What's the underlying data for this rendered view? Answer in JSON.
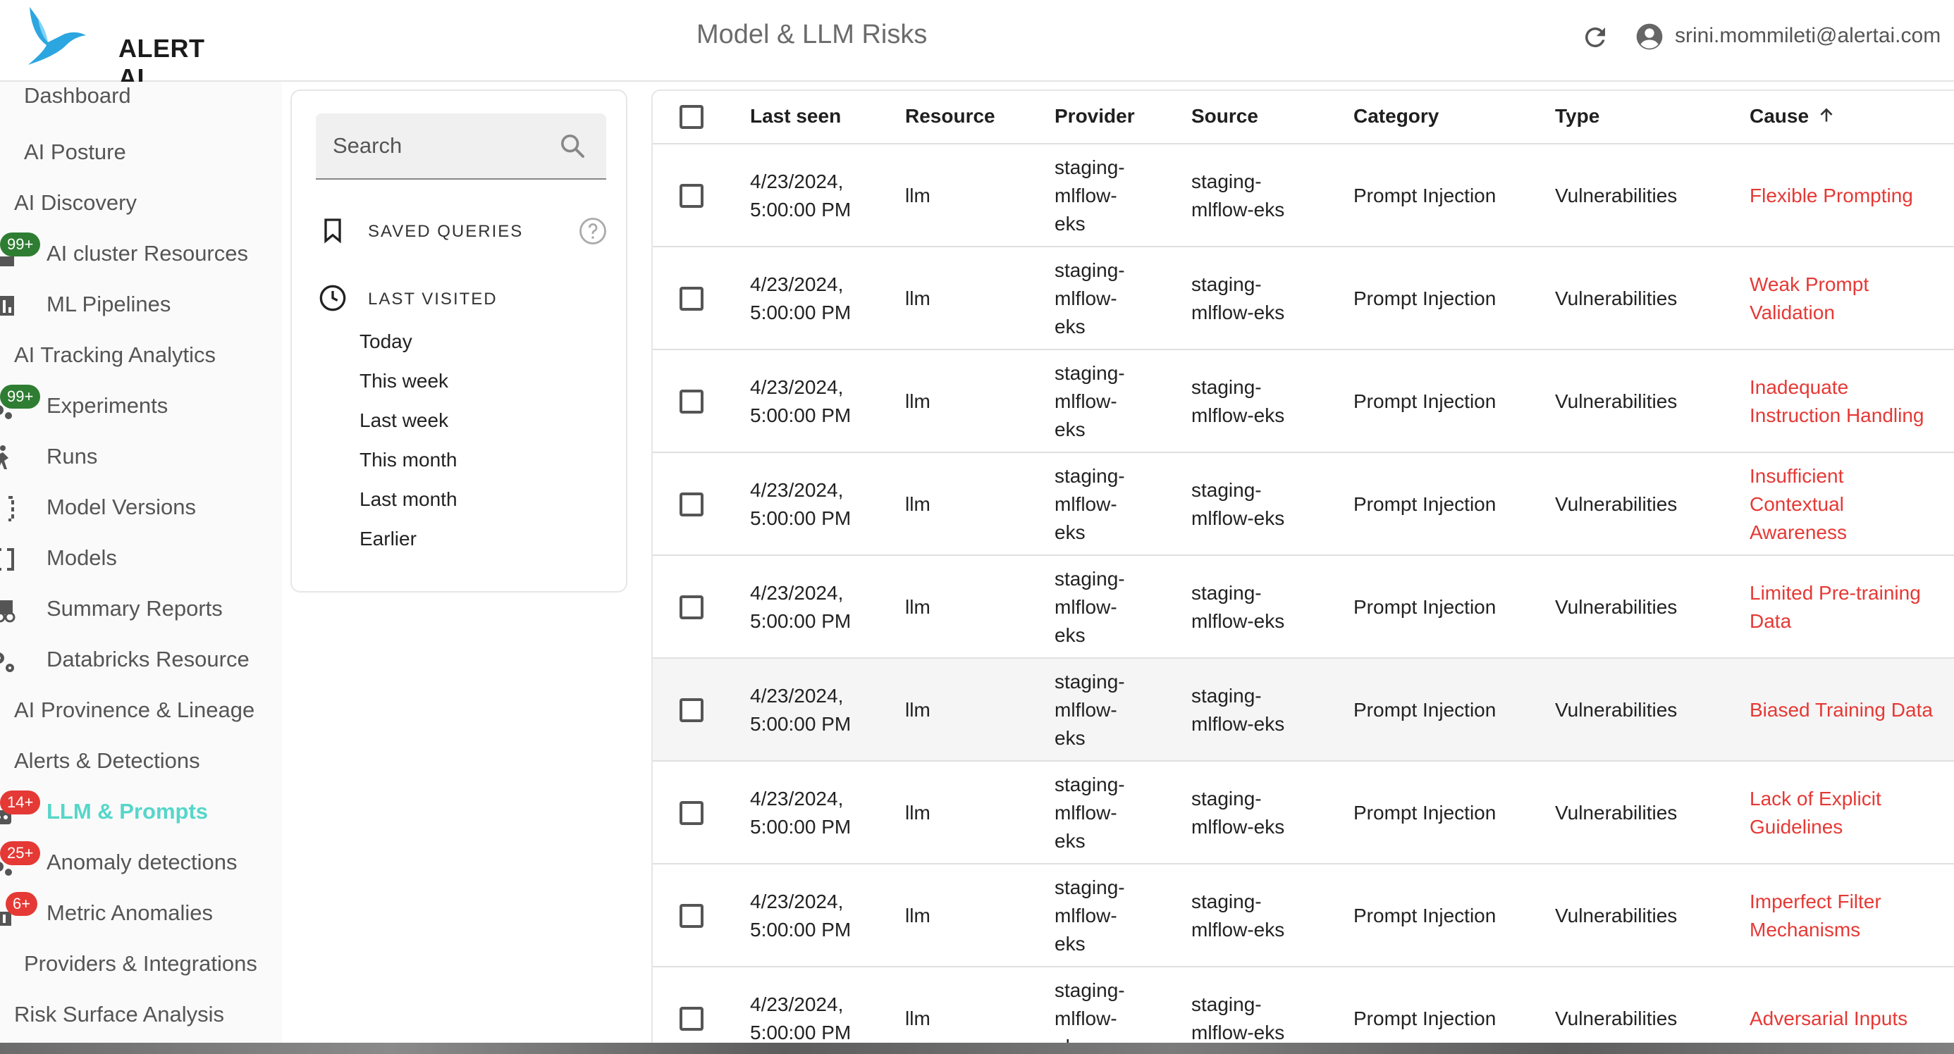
{
  "header": {
    "logo_text": "ALERT AI",
    "page_title": "Model & LLM Risks",
    "user_email": "srini.mommileti@alertai.com",
    "icons": {
      "refresh": "refresh-icon",
      "account": "account-circle-icon"
    },
    "brand_color": "#2ca6e0"
  },
  "sidebar": {
    "active_color": "#56d6c9",
    "items": [
      {
        "label": "Dashboard",
        "icon": null,
        "badge": null
      },
      {
        "label": "AI Posture",
        "icon": null,
        "badge": null
      },
      {
        "label": "AI Discovery",
        "icon": null,
        "badge": null
      },
      {
        "label": "AI cluster Resources",
        "icon": "dns-icon",
        "badge": "99+"
      },
      {
        "label": "ML Pipelines",
        "icon": "bar-chart-icon",
        "badge": null
      },
      {
        "label": "AI Tracking Analytics",
        "icon": null,
        "badge": null
      },
      {
        "label": "Experiments",
        "icon": "settings-cluster-icon",
        "badge": "99+"
      },
      {
        "label": "Runs",
        "icon": "runner-icon",
        "badge": null
      },
      {
        "label": "Model Versions",
        "icon": "bracket-icon",
        "badge": null
      },
      {
        "label": "Models",
        "icon": "bracket-icon",
        "badge": null
      },
      {
        "label": "Summary Reports",
        "icon": "report-icon",
        "badge": null
      },
      {
        "label": "Databricks Resource",
        "icon": "gears-icon",
        "badge": null
      },
      {
        "label": "AI Provinence & Lineage",
        "icon": null,
        "badge": null
      },
      {
        "label": "Alerts & Detections",
        "icon": null,
        "badge": null
      },
      {
        "label": "LLM & Prompts",
        "icon": "robot-icon",
        "badge": "14+"
      },
      {
        "label": "Anomaly detections",
        "icon": "gears-icon",
        "badge": "25+"
      },
      {
        "label": "Metric Anomalies",
        "icon": "bar-chart-icon",
        "badge": "6+"
      },
      {
        "label": "Providers & Integrations",
        "icon": null,
        "badge": null
      },
      {
        "label": "Risk Surface Analysis",
        "icon": null,
        "badge": null
      }
    ]
  },
  "filters": {
    "search_placeholder": "Search",
    "saved_queries_label": "SAVED QUERIES",
    "last_visited_label": "LAST VISITED",
    "last_visited_items": [
      "Today",
      "This week",
      "Last week",
      "This month",
      "Last month",
      "Earlier"
    ]
  },
  "table": {
    "columns": [
      "Last seen",
      "Resource",
      "Provider",
      "Source",
      "Category",
      "Type",
      "Cause"
    ],
    "sort_column": "Cause",
    "sort_direction": "ascending",
    "rows": [
      {
        "last_seen": "4/23/2024,\n5:00:00 PM",
        "resource": "llm",
        "provider": "staging-\nmlflow-\neks",
        "source": "staging-\nmlflow-eks",
        "category": "Prompt Injection",
        "type": "Vulnerabilities",
        "cause": "Flexible Prompting"
      },
      {
        "last_seen": "4/23/2024,\n5:00:00 PM",
        "resource": "llm",
        "provider": "staging-\nmlflow-\neks",
        "source": "staging-\nmlflow-eks",
        "category": "Prompt Injection",
        "type": "Vulnerabilities",
        "cause": "Weak Prompt\nValidation"
      },
      {
        "last_seen": "4/23/2024,\n5:00:00 PM",
        "resource": "llm",
        "provider": "staging-\nmlflow-\neks",
        "source": "staging-\nmlflow-eks",
        "category": "Prompt Injection",
        "type": "Vulnerabilities",
        "cause": "Inadequate\nInstruction Handling"
      },
      {
        "last_seen": "4/23/2024,\n5:00:00 PM",
        "resource": "llm",
        "provider": "staging-\nmlflow-\neks",
        "source": "staging-\nmlflow-eks",
        "category": "Prompt Injection",
        "type": "Vulnerabilities",
        "cause": "Insufficient\nContextual\nAwareness"
      },
      {
        "last_seen": "4/23/2024,\n5:00:00 PM",
        "resource": "llm",
        "provider": "staging-\nmlflow-\neks",
        "source": "staging-\nmlflow-eks",
        "category": "Prompt Injection",
        "type": "Vulnerabilities",
        "cause": "Limited Pre-training\nData"
      },
      {
        "last_seen": "4/23/2024,\n5:00:00 PM",
        "resource": "llm",
        "provider": "staging-\nmlflow-\neks",
        "source": "staging-\nmlflow-eks",
        "category": "Prompt Injection",
        "type": "Vulnerabilities",
        "cause": "Biased Training Data"
      },
      {
        "last_seen": "4/23/2024,\n5:00:00 PM",
        "resource": "llm",
        "provider": "staging-\nmlflow-\neks",
        "source": "staging-\nmlflow-eks",
        "category": "Prompt Injection",
        "type": "Vulnerabilities",
        "cause": "Lack of Explicit\nGuidelines"
      },
      {
        "last_seen": "4/23/2024,\n5:00:00 PM",
        "resource": "llm",
        "provider": "staging-\nmlflow-\neks",
        "source": "staging-\nmlflow-eks",
        "category": "Prompt Injection",
        "type": "Vulnerabilities",
        "cause": "Imperfect Filter\nMechanisms"
      },
      {
        "last_seen": "4/23/2024,\n5:00:00 PM",
        "resource": "llm",
        "provider": "staging-\nmlflow-\neks",
        "source": "staging-\nmlflow-eks",
        "category": "Prompt Injection",
        "type": "Vulnerabilities",
        "cause": "Adversarial Inputs"
      }
    ],
    "cause_color": "#e53935"
  }
}
